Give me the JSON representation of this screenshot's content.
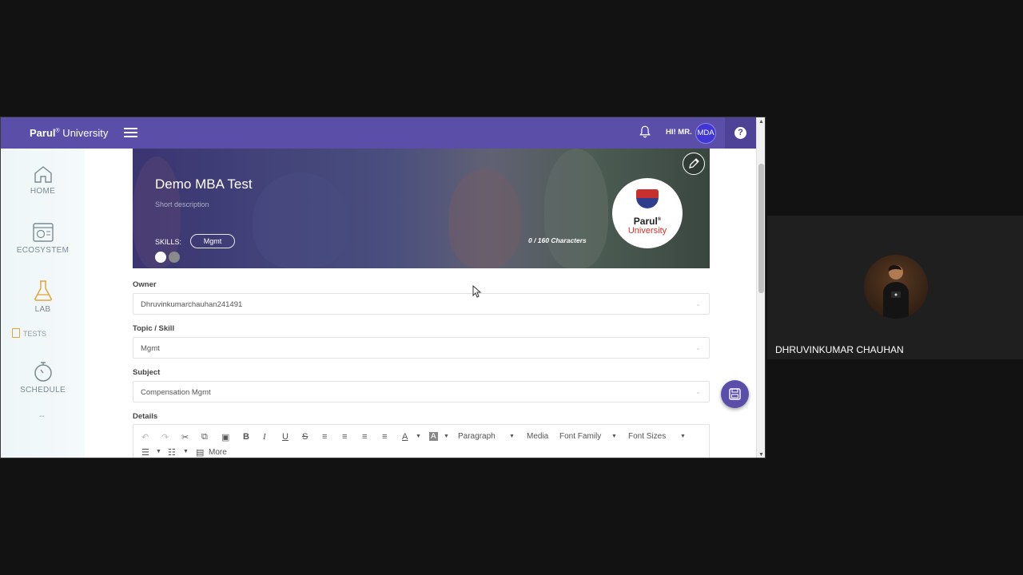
{
  "app": {
    "brand_bold": "Parul",
    "brand_sup": "®",
    "brand_rest": " University",
    "greeting": "HI! MR.",
    "avatar_initials": "MDA",
    "accent": "#5b4ea8"
  },
  "sidebar": {
    "items": [
      {
        "label": "HOME",
        "icon": "home-icon"
      },
      {
        "label": "ECOSYSTEM",
        "icon": "ecosystem-icon"
      },
      {
        "label": "LAB",
        "icon": "flask-icon"
      },
      {
        "label": "TESTS",
        "icon": "document-icon"
      },
      {
        "label": "SCHEDULE",
        "icon": "stopwatch-icon"
      }
    ],
    "more": "--"
  },
  "banner": {
    "title": "Demo MBA Test",
    "description": "Short description",
    "skills_label": "SKILLS:",
    "skill_chip": "Mgmt",
    "char_count": "0 / 160 Characters",
    "logo_name": "Parul",
    "logo_sup": "®",
    "logo_sub": "University"
  },
  "form": {
    "owner_label": "Owner",
    "owner_value": "Dhruvinkumarchauhan241491",
    "topic_label": "Topic / Skill",
    "topic_value": "Mgmt",
    "subject_label": "Subject",
    "subject_value": "Compensation Mgmt",
    "details_label": "Details"
  },
  "editor": {
    "paragraph": "Paragraph",
    "media": "Media",
    "font_family": "Font Family",
    "font_sizes": "Font Sizes",
    "more": "More"
  },
  "participant": {
    "name": "DHRUVINKUMAR CHAUHAN"
  }
}
